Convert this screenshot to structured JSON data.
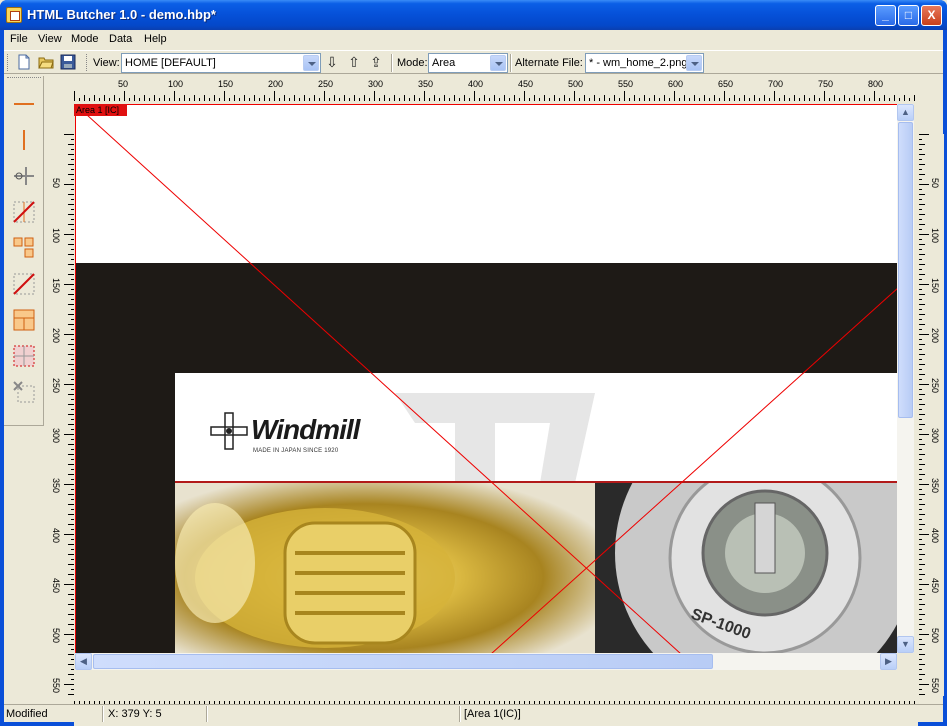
{
  "window": {
    "title": "HTML Butcher 1.0 - demo.hbp*",
    "minimize_label": "_",
    "maximize_label": "□",
    "close_label": "X"
  },
  "menu": {
    "items": [
      {
        "label": "File"
      },
      {
        "label": "View"
      },
      {
        "label": "Mode"
      },
      {
        "label": "Data"
      },
      {
        "label": "Help"
      }
    ]
  },
  "toolbar": {
    "view_label": "View:",
    "view_value": "HOME [DEFAULT]",
    "mode_label": "Mode:",
    "mode_value": "Area",
    "alternate_label": "Alternate File:",
    "alternate_value": "* - wm_home_2.png"
  },
  "rulers": {
    "horizontal_ticks": [
      "50",
      "100",
      "150",
      "200",
      "250",
      "300",
      "350",
      "400",
      "450",
      "500",
      "550",
      "600",
      "650",
      "700",
      "750",
      "800"
    ],
    "vertical_ticks": [
      "50",
      "100",
      "150",
      "200",
      "250",
      "300",
      "350",
      "400",
      "450",
      "500",
      "550"
    ]
  },
  "canvas": {
    "area_tag": "Area 1 [IC]",
    "brand": "Windmill",
    "tagline": "MADE IN JAPAN SINCE 1920",
    "photo_text": "SP-1000"
  },
  "status": {
    "state": "Modified",
    "coords": "X: 379 Y: 5",
    "area": "[Area 1(IC)]"
  },
  "colors": {
    "title_blue": "#0550d8",
    "area_red": "#e01010",
    "chrome": "#ece9d8"
  }
}
